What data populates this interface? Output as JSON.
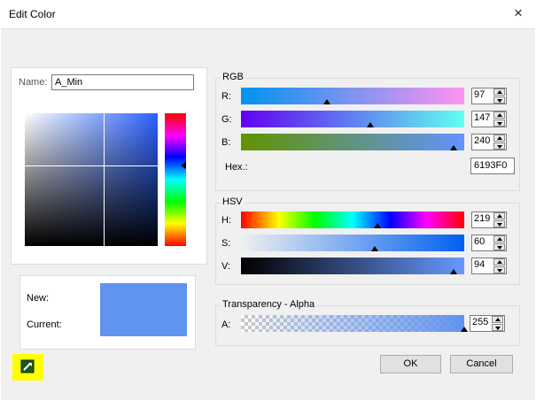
{
  "window": {
    "title": "Edit Color",
    "close_glyph": "×"
  },
  "name_field": {
    "label": "Name:",
    "value": "A_Min"
  },
  "picker": {
    "selected_saturation": 0.6,
    "selected_value": 0.94,
    "hue_degrees": 219
  },
  "preview": {
    "new_label": "New:",
    "current_label": "Current:",
    "new_color": "#6193F0",
    "current_color": "#6193F0"
  },
  "rgb": {
    "legend": "RGB",
    "channels": [
      {
        "label": "R:",
        "value": "97"
      },
      {
        "label": "G:",
        "value": "147"
      },
      {
        "label": "B:",
        "value": "240"
      }
    ],
    "hex_label": "Hex.:",
    "hex_value": "6193F0"
  },
  "hsv": {
    "legend": "HSV",
    "channels": [
      {
        "label": "H:",
        "value": "219"
      },
      {
        "label": "S:",
        "value": "60"
      },
      {
        "label": "V:",
        "value": "94"
      }
    ]
  },
  "alpha": {
    "legend": "Transparency  - Alpha",
    "label": "A:",
    "value": "255"
  },
  "buttons": {
    "ok": "OK",
    "cancel": "Cancel"
  },
  "eyedropper": {
    "icon": "eyedropper-icon",
    "highlight_color": "#FFFF00"
  }
}
